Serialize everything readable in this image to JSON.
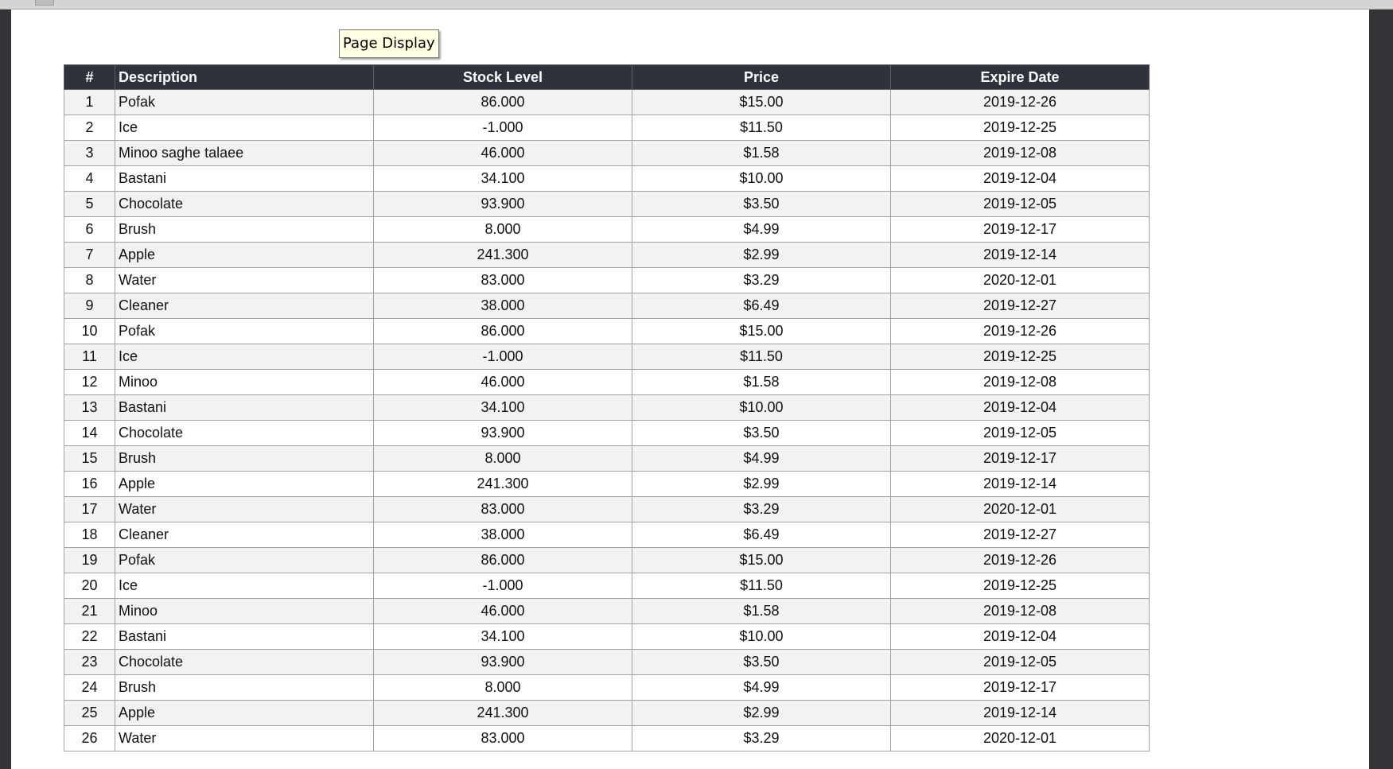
{
  "tooltip": {
    "text": "Page Display"
  },
  "table": {
    "columns": [
      "#",
      "Description",
      "Stock Level",
      "Price",
      "Expire Date"
    ],
    "rows": [
      [
        "1",
        "Pofak",
        "86.000",
        "$15.00",
        "2019-12-26"
      ],
      [
        "2",
        "Ice",
        "-1.000",
        "$11.50",
        "2019-12-25"
      ],
      [
        "3",
        "Minoo saghe talaee",
        "46.000",
        "$1.58",
        "2019-12-08"
      ],
      [
        "4",
        "Bastani",
        "34.100",
        "$10.00",
        "2019-12-04"
      ],
      [
        "5",
        "Chocolate",
        "93.900",
        "$3.50",
        "2019-12-05"
      ],
      [
        "6",
        "Brush",
        "8.000",
        "$4.99",
        "2019-12-17"
      ],
      [
        "7",
        "Apple",
        "241.300",
        "$2.99",
        "2019-12-14"
      ],
      [
        "8",
        "Water",
        "83.000",
        "$3.29",
        "2020-12-01"
      ],
      [
        "9",
        "Cleaner",
        "38.000",
        "$6.49",
        "2019-12-27"
      ],
      [
        "10",
        "Pofak",
        "86.000",
        "$15.00",
        "2019-12-26"
      ],
      [
        "11",
        "Ice",
        "-1.000",
        "$11.50",
        "2019-12-25"
      ],
      [
        "12",
        "Minoo",
        "46.000",
        "$1.58",
        "2019-12-08"
      ],
      [
        "13",
        "Bastani",
        "34.100",
        "$10.00",
        "2019-12-04"
      ],
      [
        "14",
        "Chocolate",
        "93.900",
        "$3.50",
        "2019-12-05"
      ],
      [
        "15",
        "Brush",
        "8.000",
        "$4.99",
        "2019-12-17"
      ],
      [
        "16",
        "Apple",
        "241.300",
        "$2.99",
        "2019-12-14"
      ],
      [
        "17",
        "Water",
        "83.000",
        "$3.29",
        "2020-12-01"
      ],
      [
        "18",
        "Cleaner",
        "38.000",
        "$6.49",
        "2019-12-27"
      ],
      [
        "19",
        "Pofak",
        "86.000",
        "$15.00",
        "2019-12-26"
      ],
      [
        "20",
        "Ice",
        "-1.000",
        "$11.50",
        "2019-12-25"
      ],
      [
        "21",
        "Minoo",
        "46.000",
        "$1.58",
        "2019-12-08"
      ],
      [
        "22",
        "Bastani",
        "34.100",
        "$10.00",
        "2019-12-04"
      ],
      [
        "23",
        "Chocolate",
        "93.900",
        "$3.50",
        "2019-12-05"
      ],
      [
        "24",
        "Brush",
        "8.000",
        "$4.99",
        "2019-12-17"
      ],
      [
        "25",
        "Apple",
        "241.300",
        "$2.99",
        "2019-12-14"
      ],
      [
        "26",
        "Water",
        "83.000",
        "$3.29",
        "2020-12-01"
      ]
    ]
  }
}
